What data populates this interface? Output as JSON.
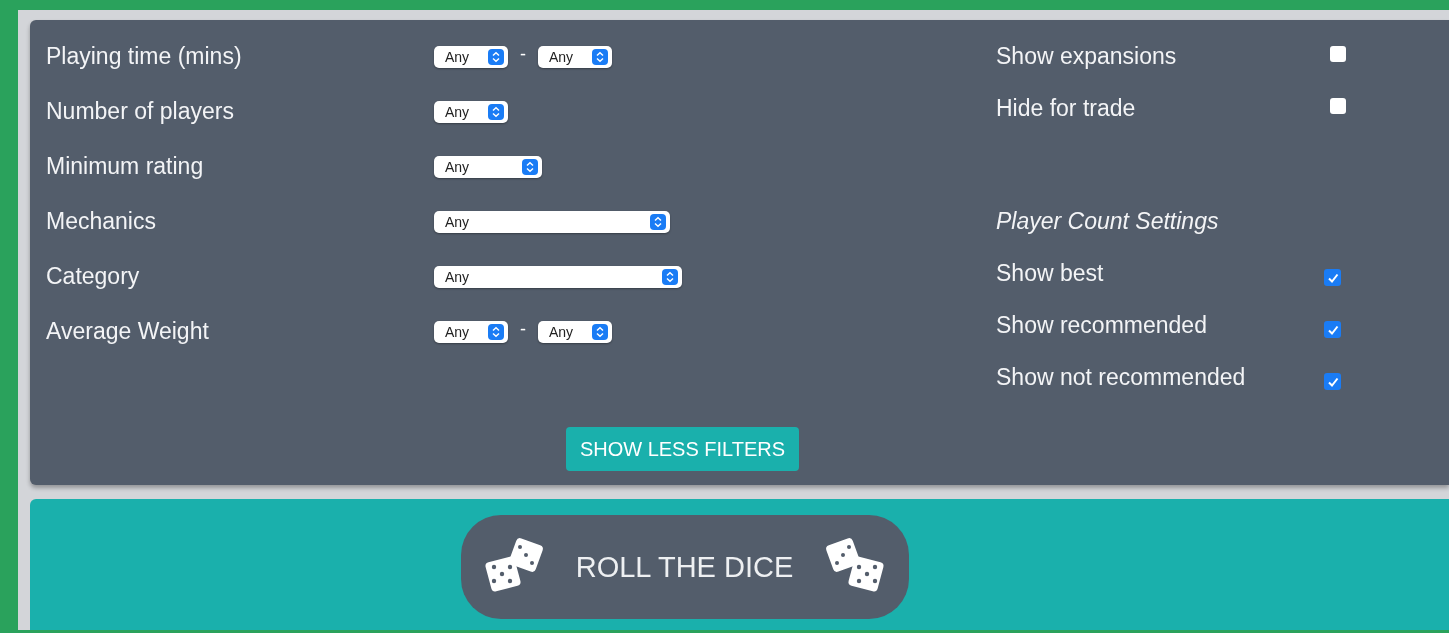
{
  "filters": [
    {
      "label": "Playing time (mins)",
      "selects": [
        {
          "value": "Any"
        },
        {
          "value": "Any"
        }
      ],
      "separator": "-"
    },
    {
      "label": "Number of players",
      "selects": [
        {
          "value": "Any"
        }
      ]
    },
    {
      "label": "Minimum rating",
      "selects": [
        {
          "value": "Any"
        }
      ]
    },
    {
      "label": "Mechanics",
      "selects": [
        {
          "value": "Any"
        }
      ]
    },
    {
      "label": "Category",
      "selects": [
        {
          "value": "Any"
        }
      ]
    },
    {
      "label": "Average Weight",
      "selects": [
        {
          "value": "Any"
        },
        {
          "value": "Any"
        }
      ],
      "separator": "-"
    }
  ],
  "options": [
    {
      "kind": "checkbox",
      "label": "Show expansions",
      "checked": false
    },
    {
      "kind": "checkbox",
      "label": "Hide for trade",
      "checked": false
    },
    {
      "kind": "heading",
      "label": "Player Count Settings"
    },
    {
      "kind": "checkbox",
      "label": "Show best",
      "checked": true
    },
    {
      "kind": "checkbox",
      "label": "Show recommended",
      "checked": true
    },
    {
      "kind": "checkbox",
      "label": "Show not recommended",
      "checked": true
    }
  ],
  "toggle_button": "SHOW LESS FILTERS",
  "roll_button": "ROLL THE DICE"
}
